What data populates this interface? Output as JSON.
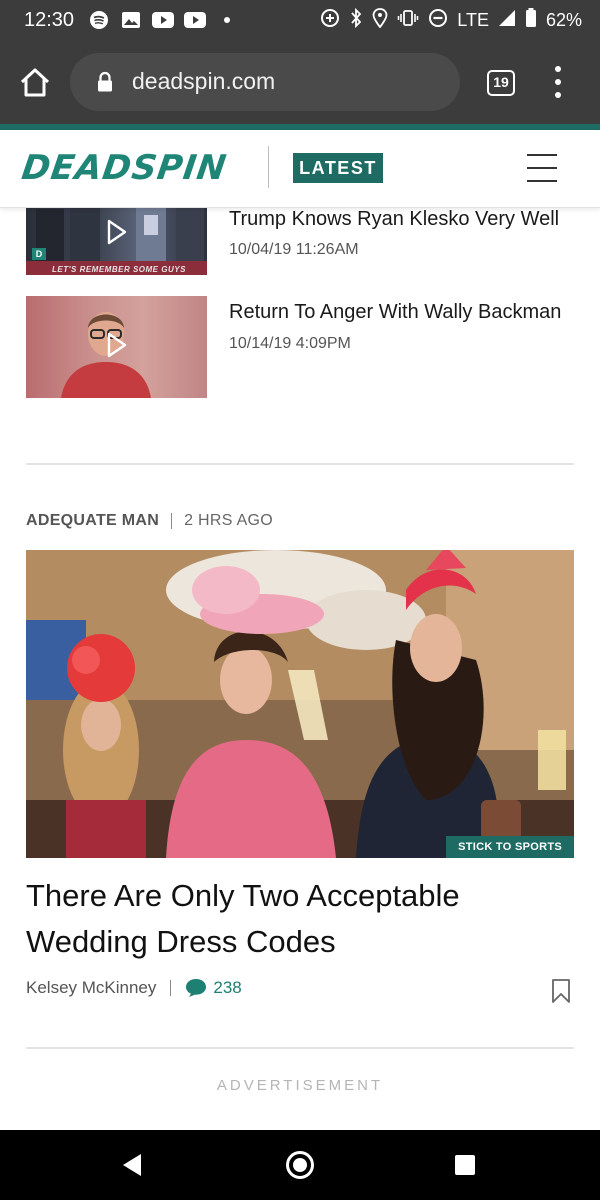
{
  "status_bar": {
    "time": "12:30",
    "network": "LTE",
    "battery": "62%",
    "left_icons": [
      "spotify-icon",
      "image-icon",
      "youtube-icon",
      "youtube-icon",
      "dot-icon"
    ],
    "right_icons": [
      "data-saver-icon",
      "bluetooth-icon",
      "location-icon",
      "vibrate-icon",
      "do-not-disturb-icon",
      "signal-icon",
      "battery-icon"
    ]
  },
  "browser": {
    "url": "deadspin.com",
    "tab_count": "19"
  },
  "header": {
    "logo": "DEADSPIN",
    "latest_label": "LATEST"
  },
  "videos": [
    {
      "title": "Trump Knows Ryan Klesko Very Well",
      "date": "10/04/19 11:26AM",
      "thumb_caption": "LET'S REMEMBER SOME GUYS",
      "thumb_logo": "D"
    },
    {
      "title": "Return To Anger With Wally Backman",
      "date": "10/14/19 4:09PM"
    }
  ],
  "article": {
    "section": "ADEQUATE MAN",
    "time_ago": "2 HRS AGO",
    "image_tag": "STICK TO SPORTS",
    "headline": "There Are Only Two Acceptable Wedding Dress Codes",
    "author": "Kelsey McKinney",
    "comment_count": "238"
  },
  "advertisement_label": "ADVERTISEMENT",
  "colors": {
    "brand": "#1e8577",
    "badge": "#1e6b63",
    "comment": "#1e7f73",
    "chrome": "#3c3c3c"
  }
}
